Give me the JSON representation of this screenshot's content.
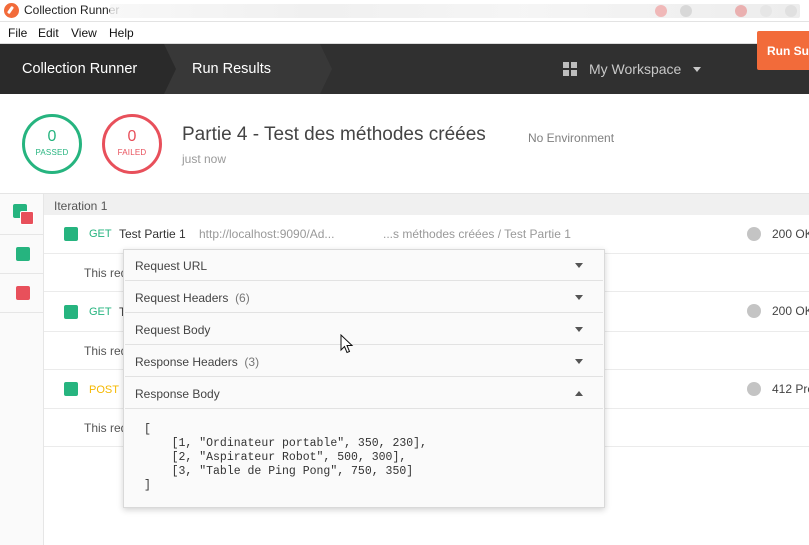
{
  "window": {
    "title": "Collection Runner"
  },
  "menu": [
    "File",
    "Edit",
    "View",
    "Help"
  ],
  "header": {
    "tab_runner": "Collection Runner",
    "tab_results": "Run Results",
    "workspace": "My Workspace"
  },
  "summary": {
    "passed_count": "0",
    "passed_label": "PASSED",
    "failed_count": "0",
    "failed_label": "FAILED",
    "run_title": "Partie 4 - Test des méthodes créées",
    "environment": "No Environment",
    "time": "just now",
    "run_summary_button": "Run Summary"
  },
  "iteration_label": "Iteration 1",
  "requests": [
    {
      "method": "GET",
      "name": "Test Partie 1",
      "url": "http://localhost:9090/Ad...",
      "path": "...s méthodes créées / Test Partie 1",
      "response": "200 OK",
      "subtext": "This req"
    },
    {
      "method": "GET",
      "name": "T",
      "response": "200 OK",
      "subtext": "This req"
    },
    {
      "method": "POST",
      "name": "",
      "response": "412 Pre",
      "subtext": "This req"
    }
  ],
  "details": {
    "request_url": "Request URL",
    "request_headers": "Request Headers",
    "request_headers_count": "(6)",
    "request_body": "Request Body",
    "response_headers": "Response Headers",
    "response_headers_count": "(3)",
    "response_body": "Response Body",
    "response_body_content": "[\n    [1, \"Ordinateur portable\", 350, 230],\n    [2, \"Aspirateur Robot\", 500, 300],\n    [3, \"Table de Ping Pong\", 750, 350]\n]"
  },
  "colors": {
    "accent": "#f26b3a",
    "pass": "#26b47f",
    "fail": "#e8505b",
    "post": "#f5b800"
  }
}
